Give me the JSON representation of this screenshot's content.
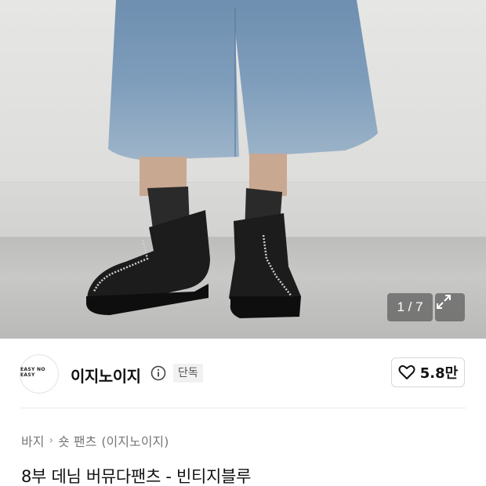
{
  "gallery": {
    "counter": "1 / 7",
    "icons": {
      "expand": "expand-icon"
    }
  },
  "seller": {
    "logo_text": "EASY NO EASY",
    "brand_name": "이지노이지",
    "exclusive_badge": "단독",
    "like_count": "5.8만",
    "icons": {
      "info": "info-icon",
      "like": "heart-outline-icon"
    }
  },
  "product": {
    "breadcrumb": [
      "바지",
      "숏 팬츠",
      "(이지노이지)"
    ],
    "title": "8부 데님 버뮤다팬츠 - 빈티지블루"
  }
}
